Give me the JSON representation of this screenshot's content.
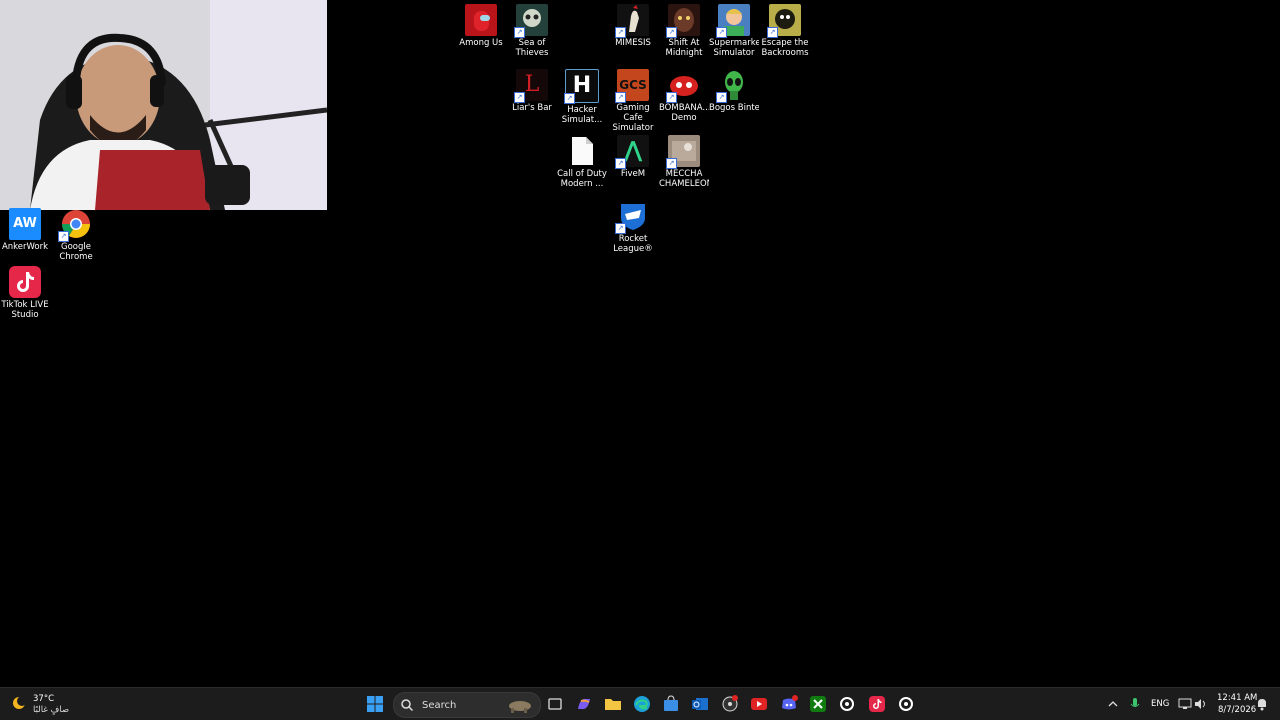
{
  "desktop_icons": {
    "among_us": "Among Us",
    "sea_of_thieves": "Sea of\nThieves",
    "mimesis": "MIMESIS",
    "shift_at_midnight": "Shift At\nMidnight",
    "supermarket_simulator": "Supermarket\nSimulator",
    "escape_backrooms": "Escape the\nBackrooms",
    "liars_bar": "Liar's Bar",
    "hacker_simulator": "Hacker\nSimulat...",
    "gaming_cafe": "Gaming Cafe\nSimulator",
    "bombana": "BOMBANA...\nDemo",
    "bogos_binted": "Bogos Binted",
    "call_of_duty": "Call of Duty\nModern ...",
    "fivem": "FiveM",
    "meccha_chameleon": "MECCHA\nCHAMELEON",
    "rocket_league": "Rocket\nLeague®",
    "ankerwork": "AnkerWork",
    "google_chrome": "Google\nChrome",
    "tiktok_live_studio": "TikTok LIVE\nStudio"
  },
  "icon_text": {
    "hacker": "H",
    "gcs": "GCS",
    "liars": "L",
    "ankerwork": "AW",
    "fivem": "⋀"
  },
  "taskbar": {
    "weather_temp": "37°C",
    "weather_desc": "صافٍ غالبًا",
    "search_placeholder": "Search",
    "lang": "ENG",
    "time": "12:41 AM",
    "date": "8/7/2026"
  },
  "colors": {
    "desktop_bg": "#000000",
    "taskbar_bg": "#1c1c1c",
    "accent": "#3a6bd6"
  }
}
